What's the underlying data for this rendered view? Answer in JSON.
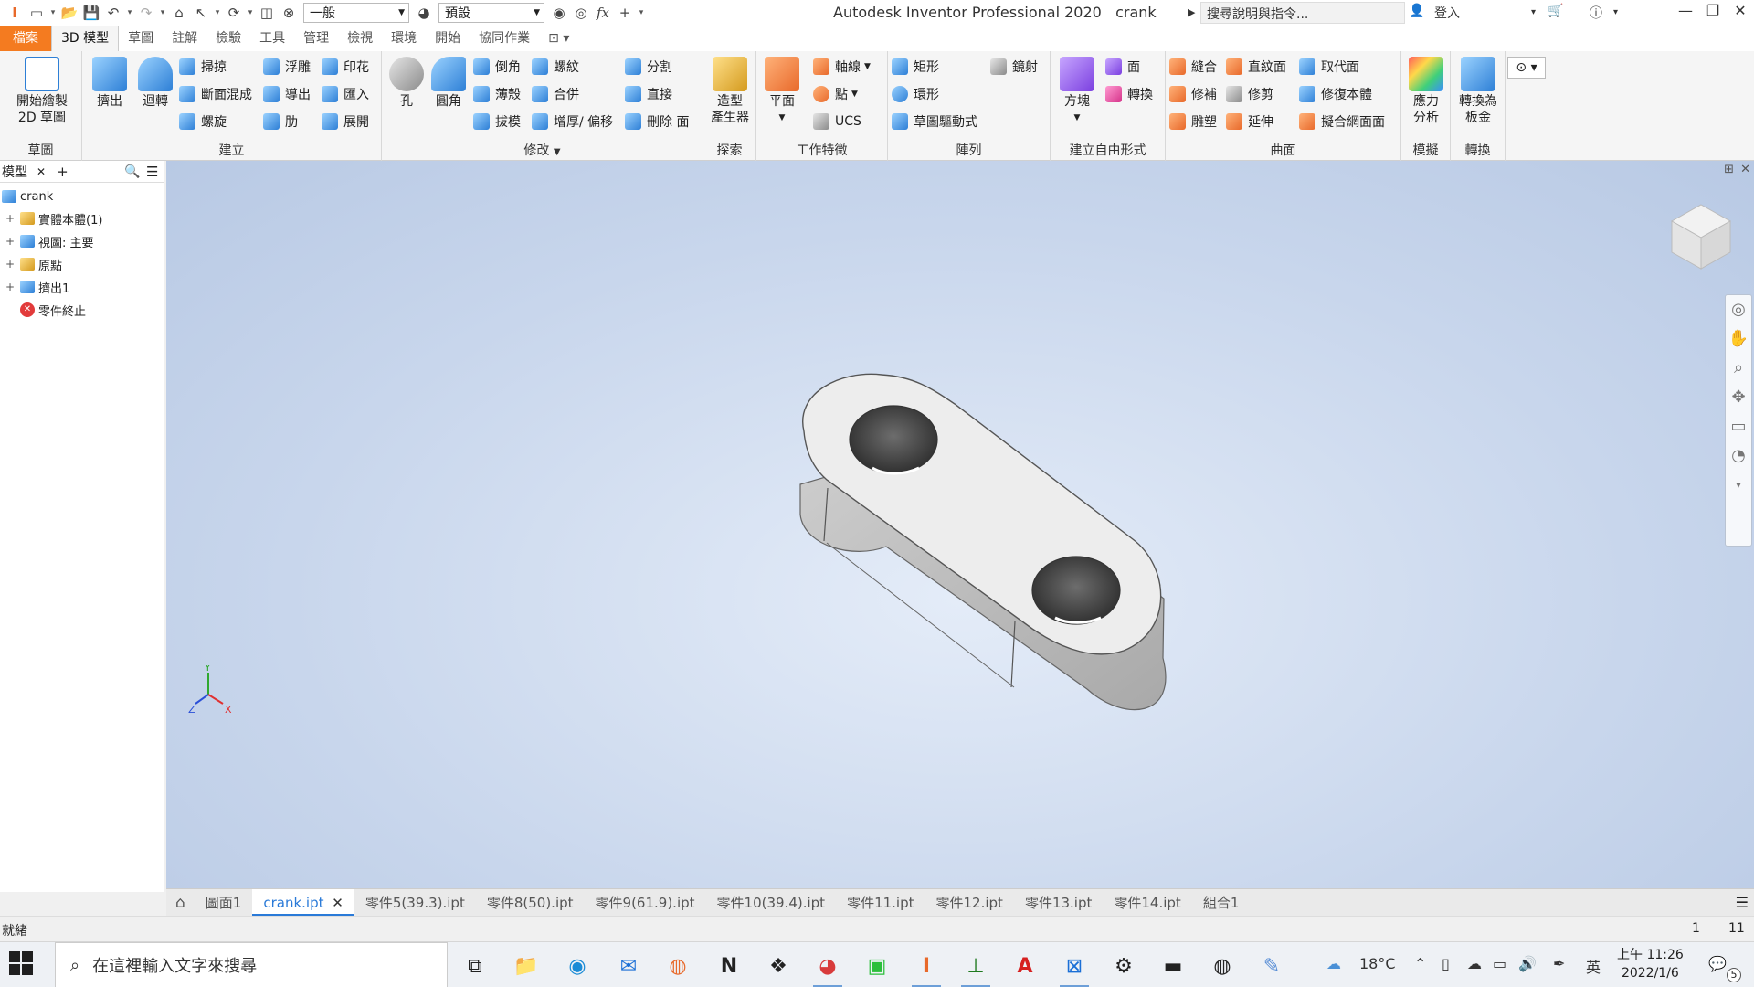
{
  "window": {
    "app_title": "Autodesk Inventor Professional 2020",
    "doc_name": "crank",
    "help_search_placeholder": "搜尋說明與指令...",
    "signin": "登入",
    "style_select": "一般",
    "appearance_select": "預設"
  },
  "ribbon_tabs": [
    "檔案",
    "3D 模型",
    "草圖",
    "註解",
    "檢驗",
    "工具",
    "管理",
    "檢視",
    "環境",
    "開始",
    "協同作業"
  ],
  "ribbon": {
    "sketch": {
      "label": "草圖",
      "start_2d": "開始繪製\n2D 草圖"
    },
    "create": {
      "label": "建立",
      "extrude": "擠出",
      "revolve": "迴轉",
      "sweep": "掃掠",
      "loft": "斷面混成",
      "coil": "螺旋",
      "emboss": "浮雕",
      "derive": "導出",
      "rib": "肋",
      "decal": "印花",
      "import": "匯入",
      "unwrap": "展開"
    },
    "modify": {
      "label": "修改",
      "hole": "孔",
      "fillet": "圓角",
      "chamfer": "倒角",
      "shell": "薄殼",
      "draft": "拔模",
      "thread": "螺紋",
      "combine": "合併",
      "thicken": "增厚/ 偏移",
      "split": "分割",
      "direct": "直接",
      "delete_face": "刪除 面"
    },
    "explore": {
      "label": "探索",
      "shape_gen": "造型\n產生器"
    },
    "work_features": {
      "label": "工作特徵",
      "plane": "平面",
      "axis": "軸線",
      "point": "點",
      "ucs": "UCS"
    },
    "pattern": {
      "label": "陣列",
      "rect": "矩形",
      "circ": "環形",
      "sketch_driven": "草圖驅動式",
      "mirror": "鏡射"
    },
    "freeform": {
      "label": "建立自由形式",
      "box": "方塊",
      "face": "面",
      "convert": "轉換"
    },
    "surface": {
      "label": "曲面",
      "stitch": "縫合",
      "patch": "修補",
      "sculpt": "雕塑",
      "ruled": "直紋面",
      "trim": "修剪",
      "extend": "延伸",
      "replace_face": "取代面",
      "repair": "修復本體",
      "fit_mesh": "擬合網面面"
    },
    "simulation": {
      "label": "模擬",
      "stress": "應力\n分析"
    },
    "convert": {
      "label": "轉換",
      "sheet_metal": "轉換為\n板金"
    }
  },
  "browser": {
    "title": "模型",
    "root": "crank",
    "items": [
      "實體本體(1)",
      "視圖: 主要",
      "原點",
      "擠出1",
      "零件終止"
    ]
  },
  "doc_tabs": [
    "圖面1",
    "crank.ipt",
    "零件5(39.3).ipt",
    "零件8(50).ipt",
    "零件9(61.9).ipt",
    "零件10(39.4).ipt",
    "零件11.ipt",
    "零件12.ipt",
    "零件13.ipt",
    "零件14.ipt",
    "組合1"
  ],
  "status": {
    "text": "就緒",
    "num1": "1",
    "num2": "11"
  },
  "taskbar": {
    "search_placeholder": "在這裡輸入文字來搜尋",
    "temperature": "18°C",
    "ime": "英",
    "time": "上午 11:26",
    "date": "2022/1/6",
    "notifications": "5"
  },
  "axis_labels": {
    "x": "X",
    "y": "Y",
    "z": "Z"
  },
  "colors": {
    "file_tab": "#f47b20",
    "accent": "#2a7ad8"
  }
}
